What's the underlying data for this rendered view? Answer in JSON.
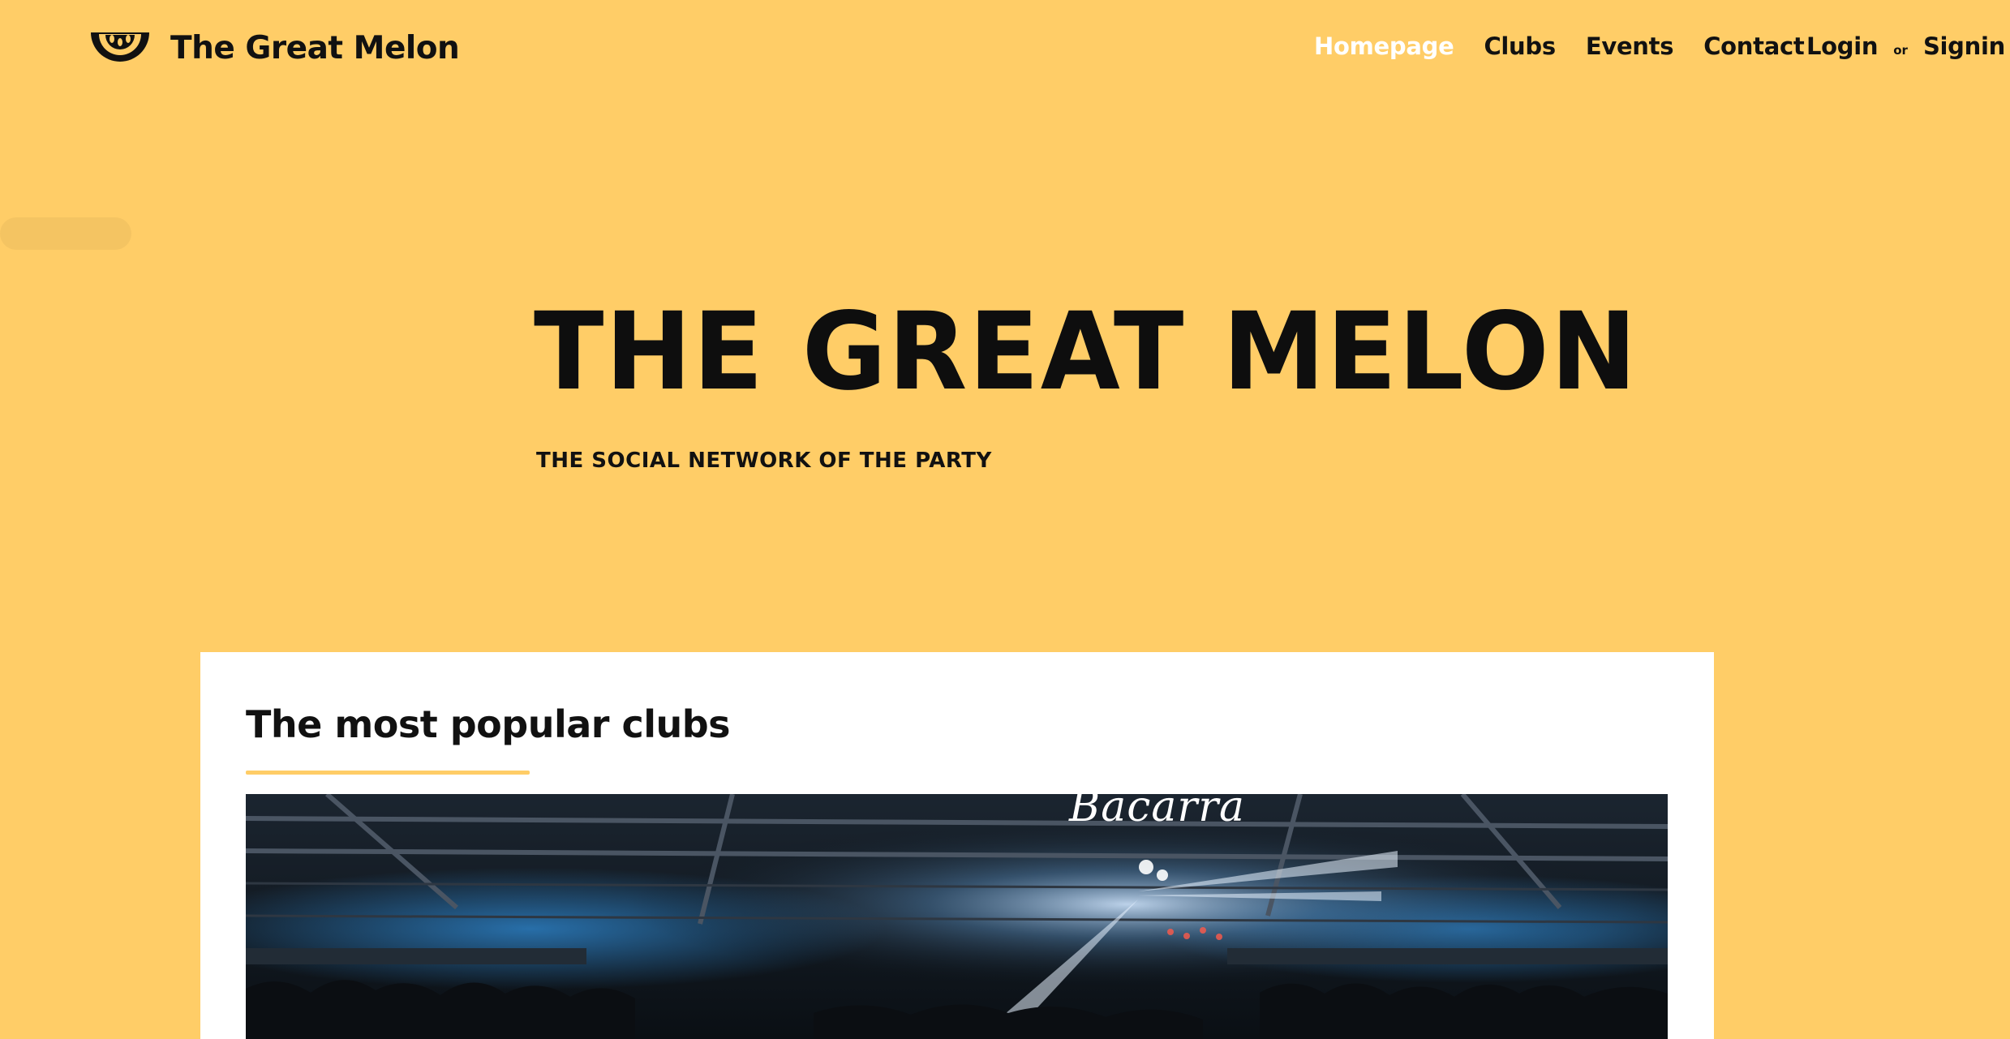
{
  "header": {
    "brand": "The Great Melon",
    "logo_icon": "melon-slice-icon",
    "nav": [
      {
        "label": "Homepage",
        "active": true
      },
      {
        "label": "Clubs",
        "active": false
      },
      {
        "label": "Events",
        "active": false
      },
      {
        "label": "Contact",
        "active": false
      }
    ],
    "auth": {
      "login": "Login",
      "or": "or",
      "signin": "Signin"
    }
  },
  "hero": {
    "title": "THE GREAT MELON",
    "subtitle": "THE SOCIAL NETWORK OF THE PARTY"
  },
  "popular_clubs": {
    "title": "The most popular clubs",
    "image_sign": "Bacarra"
  },
  "colors": {
    "background": "#FFCD67",
    "text": "#111111",
    "active_nav": "#FFFFFF",
    "card": "#FFFFFF"
  }
}
